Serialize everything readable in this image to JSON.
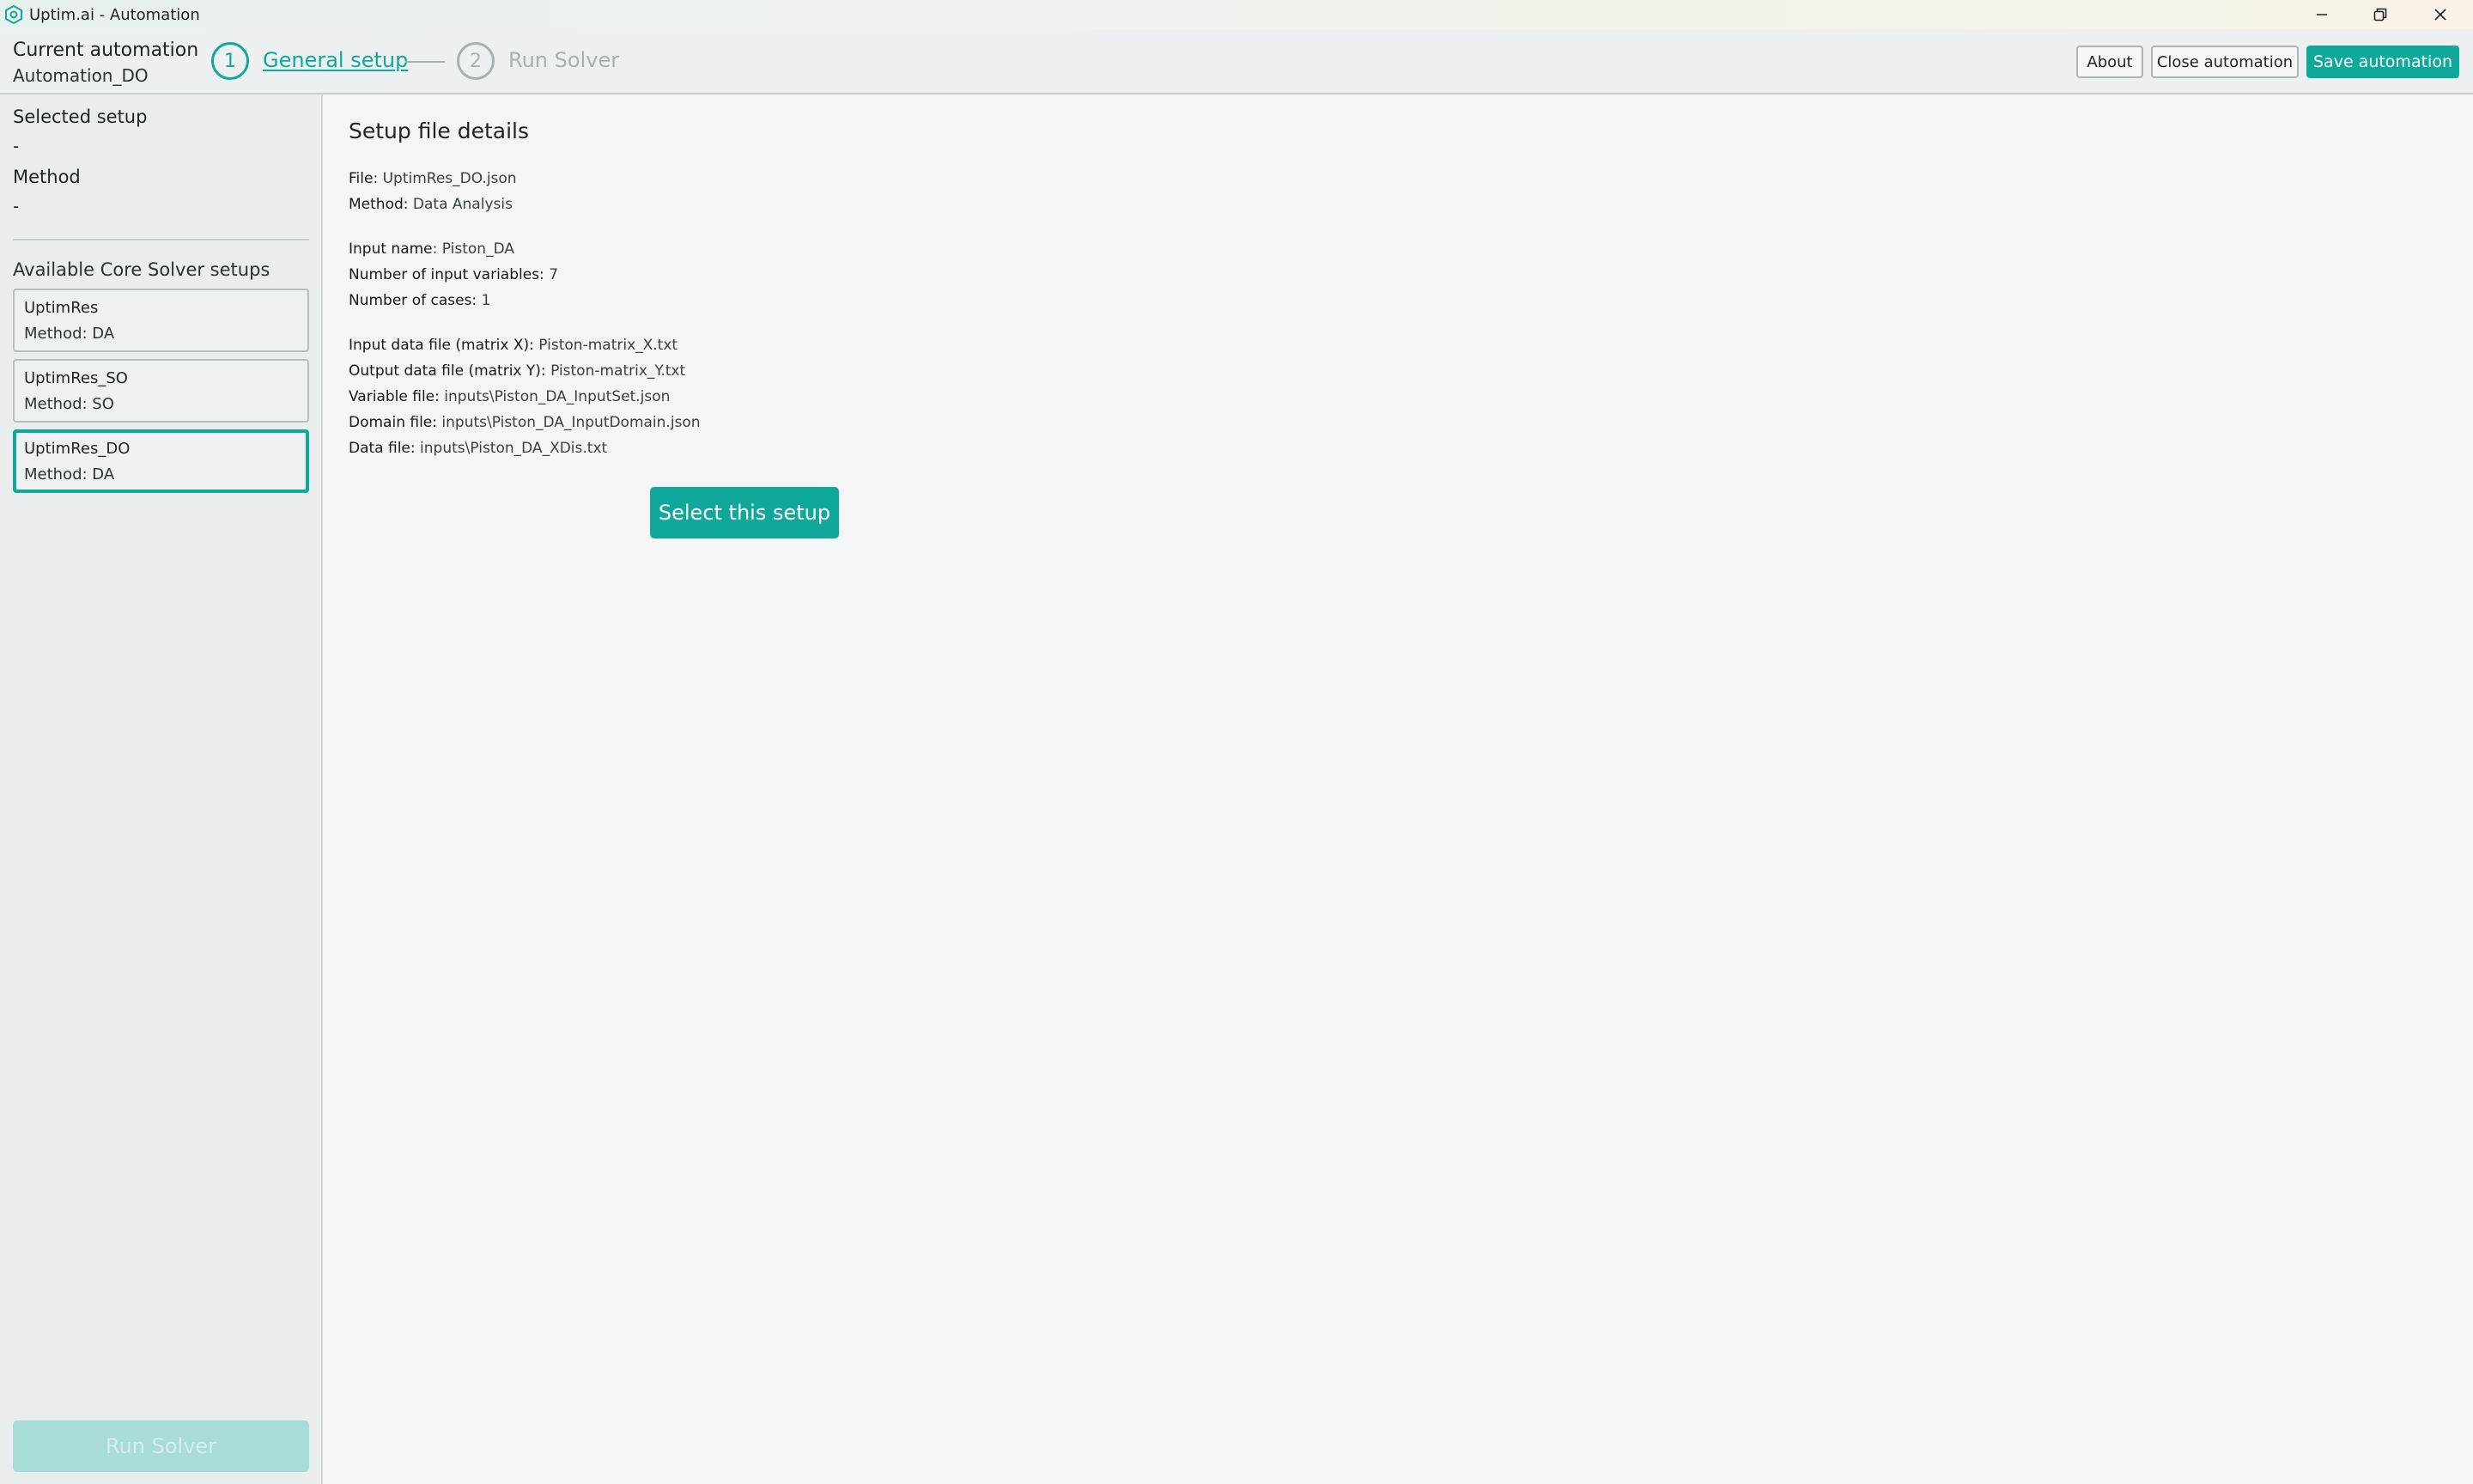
{
  "window": {
    "title": "Uptim.ai - Automation",
    "controls": [
      "minimize-icon",
      "restore-icon",
      "close-icon"
    ]
  },
  "header": {
    "current_label": "Current automation",
    "current_name": "Automation_DO",
    "steps": [
      {
        "number": "1",
        "label": "General setup",
        "state": "active"
      },
      {
        "number": "2",
        "label": "Run Solver",
        "state": "inactive"
      }
    ],
    "about_label": "About",
    "close_label": "Close automation",
    "save_label": "Save automation"
  },
  "sidebar": {
    "selected_setup_label": "Selected setup",
    "selected_setup_value": "-",
    "method_label": "Method",
    "method_value": "-",
    "available_label": "Available Core Solver setups",
    "setups": [
      {
        "name": "UptimRes",
        "method": "Method: DA",
        "selected": false
      },
      {
        "name": "UptimRes_SO",
        "method": "Method: SO",
        "selected": false
      },
      {
        "name": "UptimRes_DO",
        "method": "Method: DA",
        "selected": true
      }
    ],
    "run_label": "Run Solver"
  },
  "details": {
    "title": "Setup file details",
    "file_key": "File:",
    "file_val": "UptimRes_DO.json",
    "method_key": "Method:",
    "method_val": "Data Analysis",
    "input_name_key": "Input name:",
    "input_name_val": "Piston_DA",
    "num_vars_key": "Number of input variables:",
    "num_vars_val": "7",
    "num_cases_key": "Number of cases:",
    "num_cases_val": "1",
    "input_file_key": "Input data file (matrix X):",
    "input_file_val": "Piston-matrix_X.txt",
    "output_file_key": "Output data file (matrix Y):",
    "output_file_val": "Piston-matrix_Y.txt",
    "variable_file_key": "Variable file:",
    "variable_file_val": "inputs\\Piston_DA_InputSet.json",
    "domain_file_key": "Domain file:",
    "domain_file_val": "inputs\\Piston_DA_InputDomain.json",
    "data_file_key": "Data file:",
    "data_file_val": "inputs\\Piston_DA_XDis.txt",
    "select_label": "Select this setup"
  },
  "colors": {
    "accent": "#10a89a",
    "disabled_accent": "#a8dcd6",
    "inactive_step": "#a9b0b4"
  }
}
